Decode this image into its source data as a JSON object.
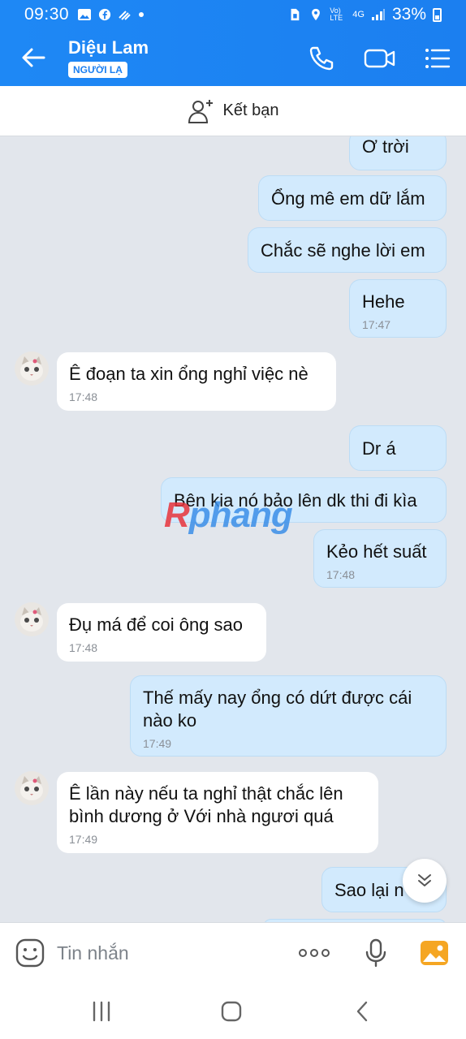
{
  "status_bar": {
    "time": "09:30",
    "battery": "33%",
    "network": "4G",
    "volte": "Vo) LTE"
  },
  "header": {
    "contact_name": "Diệu Lam",
    "badge": "NGƯỜI LẠ",
    "icons": [
      "back-arrow-icon",
      "phone-icon",
      "video-call-icon",
      "menu-list-icon"
    ]
  },
  "add_friend": {
    "label": "Kết bạn",
    "icon": "add-person-icon"
  },
  "messages": [
    {
      "side": "out",
      "text": "Ơ trời",
      "time": ""
    },
    {
      "side": "out",
      "text": "Ổng mê em dữ lắm",
      "time": ""
    },
    {
      "side": "out",
      "text": "Chắc sẽ nghe lời em",
      "time": ""
    },
    {
      "side": "out",
      "text": "Hehe",
      "time": "17:47"
    },
    {
      "side": "in",
      "text": "Ê đoạn ta xin ổng nghỉ việc nè",
      "time": "17:48"
    },
    {
      "side": "out",
      "text": "Dr á",
      "time": ""
    },
    {
      "side": "out",
      "text": "Bên kia nó bảo lên dk thi đi kìa",
      "time": ""
    },
    {
      "side": "out",
      "text": "Kẻo hết suất",
      "time": "17:48"
    },
    {
      "side": "in",
      "text": "Đụ má để coi ông sao",
      "time": "17:48"
    },
    {
      "side": "out",
      "text": "Thế mấy nay ổng có dứt được cái nào ko",
      "time": "17:49"
    },
    {
      "side": "in",
      "text": "Ê lần này nếu ta nghỉ thật chắc lên bình dương ở Với nhà ngươi quá",
      "time": "17:49"
    },
    {
      "side": "out",
      "text": "Sao lại n",
      "time": ""
    }
  ],
  "watermark": {
    "part1": "R",
    "part2": "phang"
  },
  "input_bar": {
    "placeholder": "Tin nhắn",
    "icons": [
      "emoji-icon",
      "more-dots-icon",
      "microphone-icon",
      "image-gallery-icon"
    ]
  },
  "colors": {
    "header_blue": "#1b7ff0",
    "outgoing_bubble": "#d2eafd",
    "incoming_bubble": "#ffffff",
    "chat_background": "#e2e6ec"
  }
}
